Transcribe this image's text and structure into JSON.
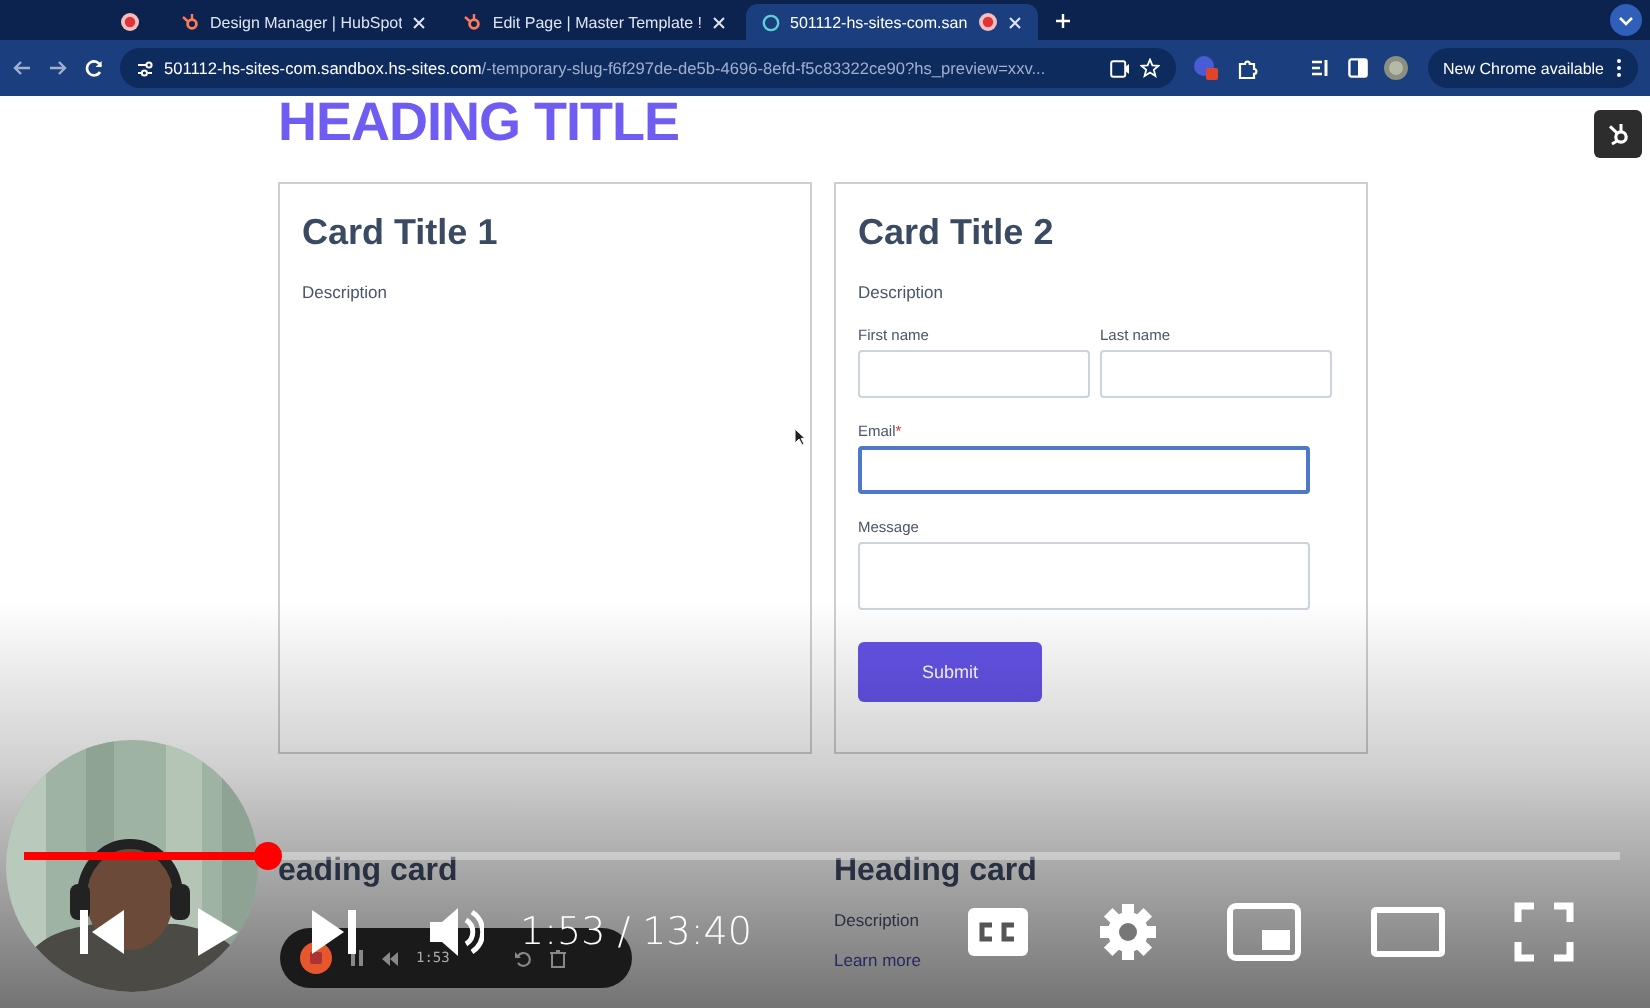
{
  "browser": {
    "tabs": [
      {
        "kind": "pinned",
        "recording": true,
        "selected": false
      },
      {
        "kind": "page",
        "title": "Design Manager | HubSpot",
        "recording": false,
        "selected": false
      },
      {
        "kind": "page",
        "title": "Edit Page | Master Template !",
        "recording": false,
        "selected": false
      },
      {
        "kind": "page",
        "title": "501112-hs-sites-com.san",
        "recording": true,
        "selected": true
      }
    ],
    "address": {
      "host": "501112-hs-sites-com.sandbox.hs-sites.com",
      "path": "/-temporary-slug-f6f297de-de5b-4696-8efd-f5c83322ce90?hs_preview=xxv..."
    },
    "update_button": "New Chrome available"
  },
  "page": {
    "heading": "HEADING TITLE",
    "cards": [
      {
        "title": "Card Title 1",
        "description": "Description"
      },
      {
        "title": "Card Title 2",
        "description": "Description",
        "form": {
          "rows": [
            [
              {
                "kind": "text",
                "label": "First name",
                "focused": false
              },
              {
                "kind": "text",
                "label": "Last name",
                "focused": false
              }
            ],
            [
              {
                "kind": "text",
                "label": "Email",
                "required_mark": "*",
                "focused": true
              }
            ],
            [
              {
                "kind": "textarea",
                "label": "Message",
                "focused": false
              }
            ]
          ],
          "submit": "Submit"
        }
      }
    ],
    "lower_cards": [
      {
        "heading": "eading card"
      },
      {
        "heading": "Heading card",
        "description": "Description",
        "link": "Learn more"
      }
    ]
  },
  "player": {
    "progress": {
      "level": 0.153
    },
    "time": "1:53 / 13:40",
    "recorder": {
      "time": "1:53"
    }
  }
}
